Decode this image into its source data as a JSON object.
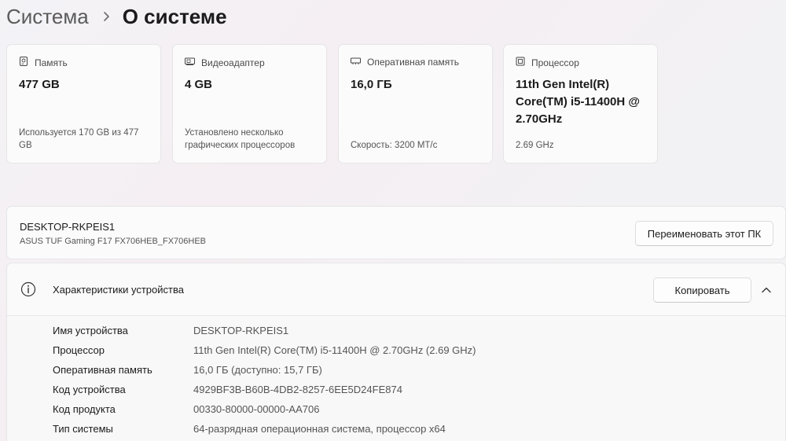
{
  "breadcrumb": {
    "parent": "Система",
    "current": "О системе"
  },
  "cards": [
    {
      "icon": "storage-icon",
      "title": "Память",
      "value": "477 GB",
      "note": "Используется 170 GB из 477 GB"
    },
    {
      "icon": "gpu-icon",
      "title": "Видеоадаптер",
      "value": "4 GB",
      "note": "Установлено несколько графических процессоров"
    },
    {
      "icon": "ram-icon",
      "title": "Оперативная память",
      "value": "16,0 ГБ",
      "note": "Скорость: 3200 МТ/с"
    },
    {
      "icon": "cpu-icon",
      "title": "Процессор",
      "value": "11th Gen Intel(R) Core(TM) i5-11400H @ 2.70GHz",
      "note": "2.69 GHz"
    }
  ],
  "device": {
    "name": "DESKTOP-RKPEIS1",
    "model": "ASUS TUF Gaming F17 FX706HEB_FX706HEB",
    "rename_label": "Переименовать этот ПК"
  },
  "specs": {
    "title": "Характеристики устройства",
    "copy_label": "Копировать",
    "rows": [
      {
        "label": "Имя устройства",
        "value": "DESKTOP-RKPEIS1"
      },
      {
        "label": "Процессор",
        "value": "11th Gen Intel(R) Core(TM) i5-11400H @ 2.70GHz (2.69 GHz)"
      },
      {
        "label": "Оперативная память",
        "value": "16,0 ГБ (доступно: 15,7 ГБ)"
      },
      {
        "label": "Код устройства",
        "value": "4929BF3B-B60B-4DB2-8257-6EE5D24FE874"
      },
      {
        "label": "Код продукта",
        "value": "00330-80000-00000-AA706"
      },
      {
        "label": "Тип системы",
        "value": "64-разрядная операционная система, процессор x64"
      }
    ]
  }
}
